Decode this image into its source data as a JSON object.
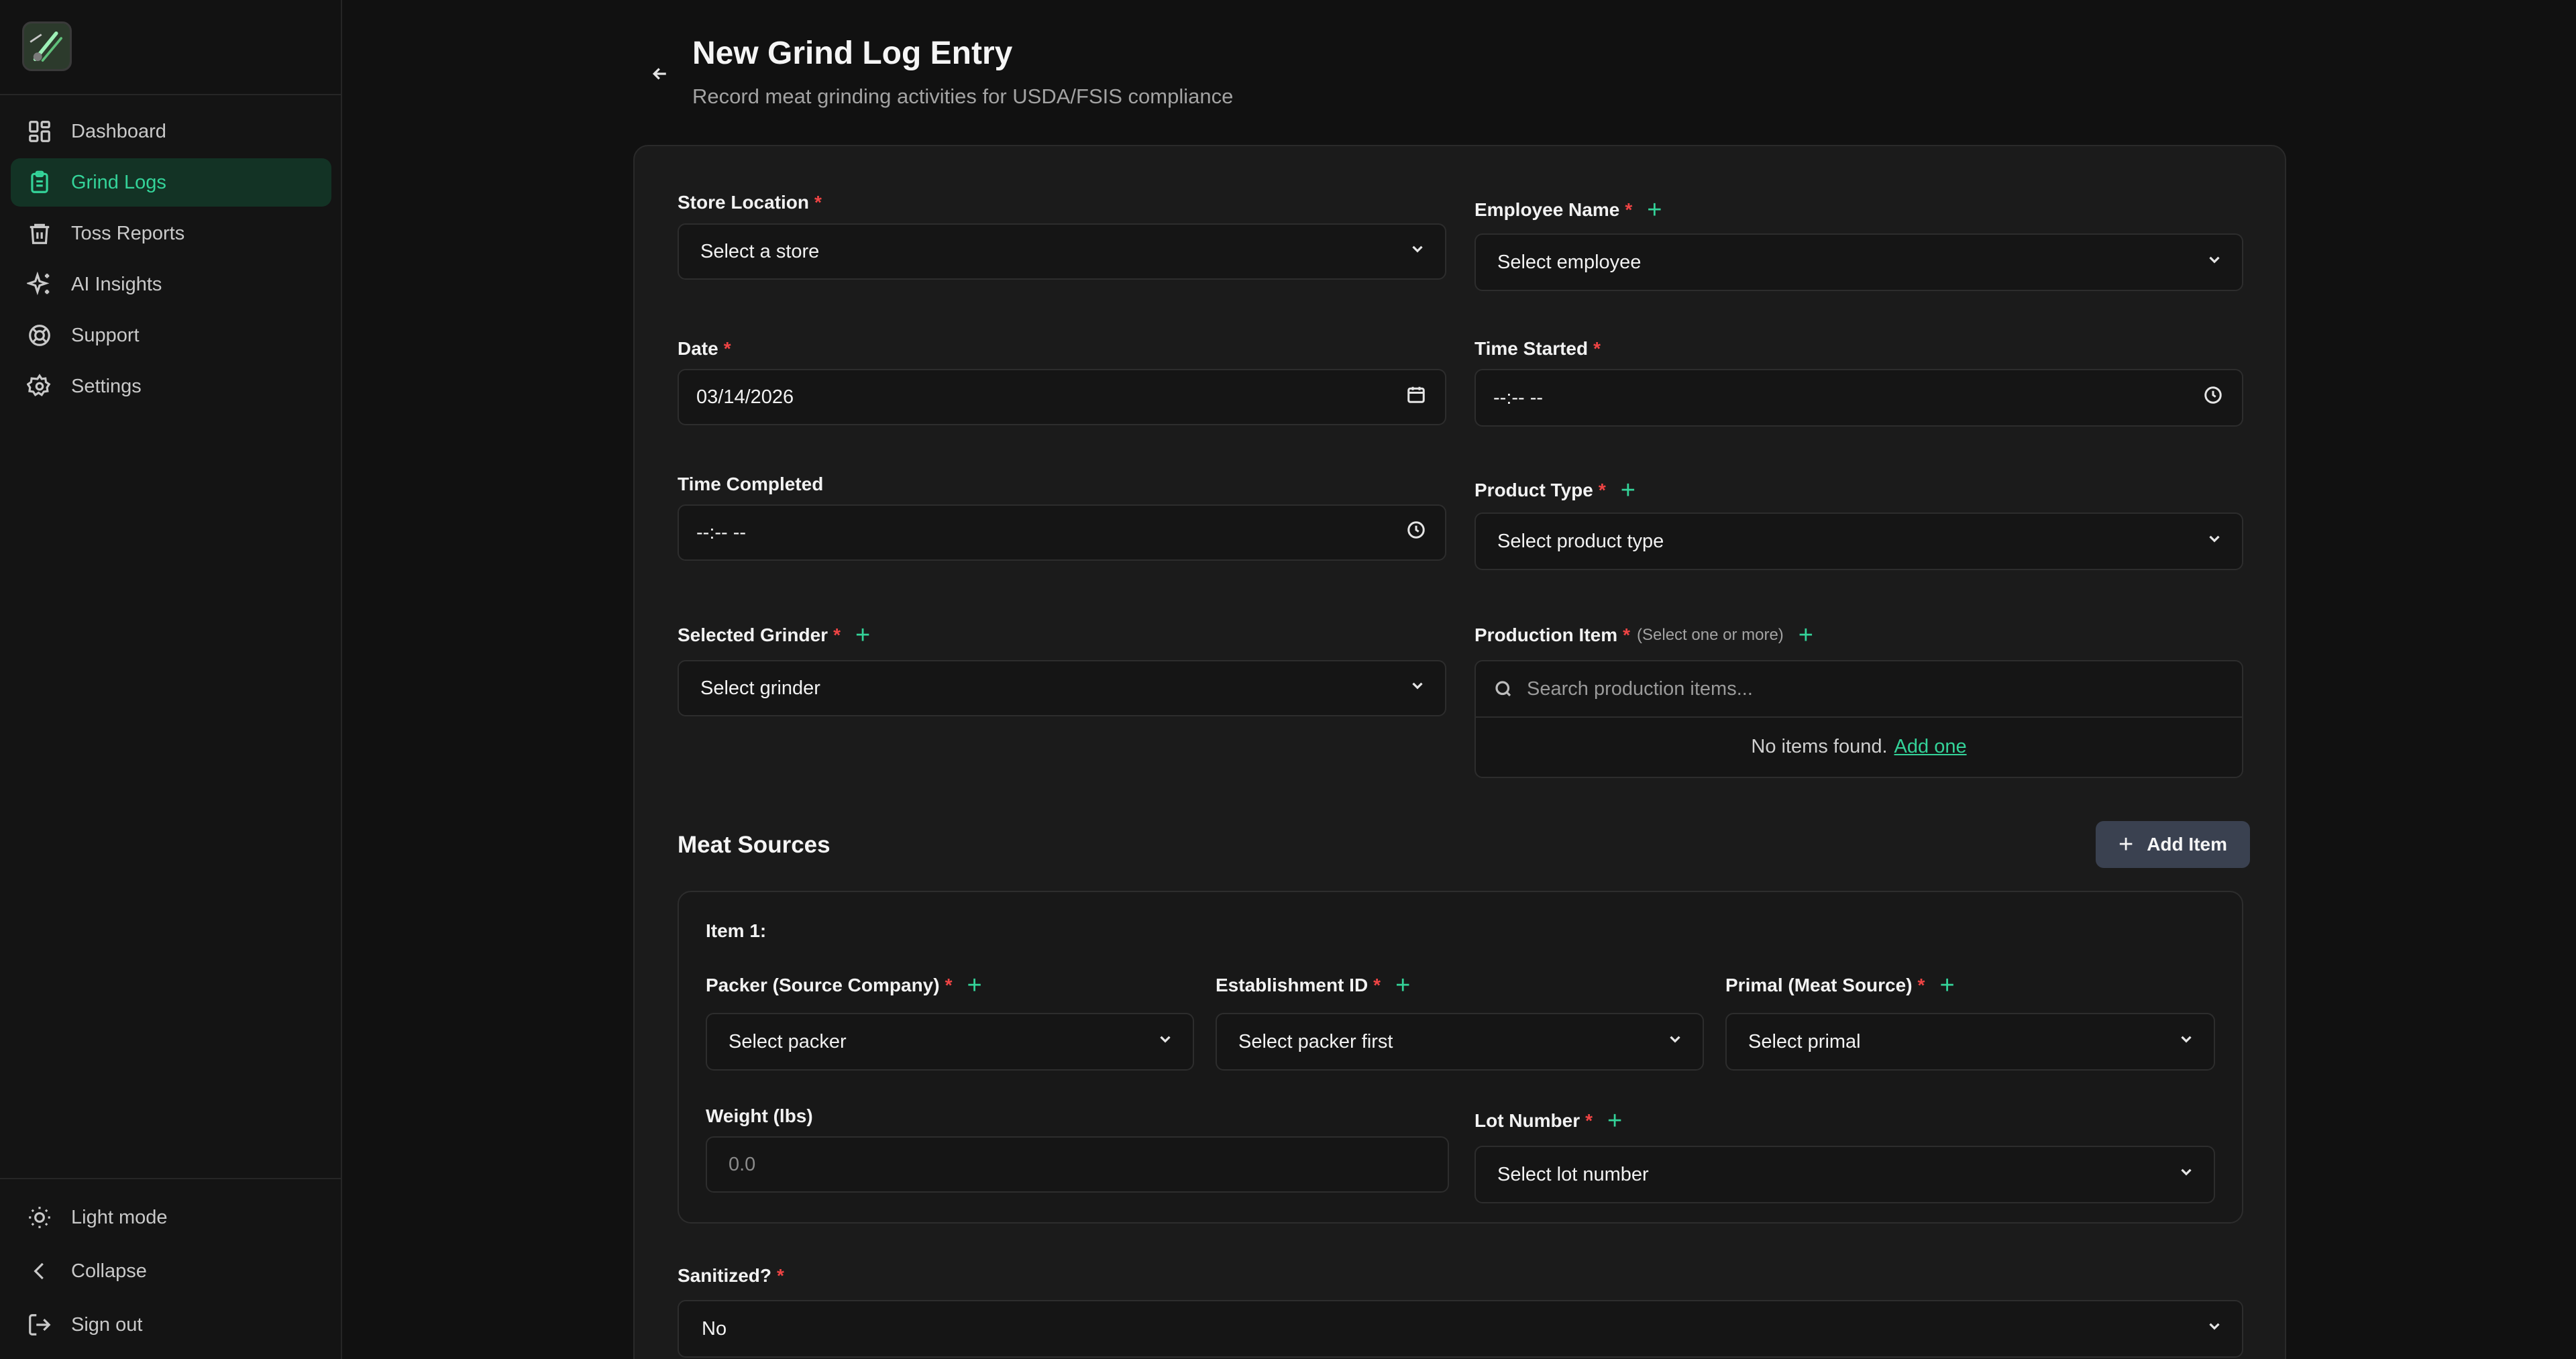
{
  "sidebar": {
    "items": [
      {
        "label": "Dashboard"
      },
      {
        "label": "Grind Logs"
      },
      {
        "label": "Toss Reports"
      },
      {
        "label": "AI Insights"
      },
      {
        "label": "Support"
      },
      {
        "label": "Settings"
      }
    ],
    "bottom": [
      {
        "label": "Light mode"
      },
      {
        "label": "Collapse"
      },
      {
        "label": "Sign out"
      }
    ],
    "active_color": "#34d399"
  },
  "header": {
    "title": "New Grind Log Entry",
    "subtitle": "Record meat grinding activities for USDA/FSIS compliance"
  },
  "form": {
    "store_location": {
      "label": "Store Location",
      "required": "*",
      "value": "Select a store"
    },
    "employee_name": {
      "label": "Employee Name",
      "required": "*",
      "value": "Select employee"
    },
    "date": {
      "label": "Date",
      "required": "*",
      "value": "03/14/2026"
    },
    "time_started": {
      "label": "Time Started",
      "required": "*",
      "value": "--:-- --"
    },
    "time_completed": {
      "label": "Time Completed",
      "value": "--:-- --"
    },
    "product_type": {
      "label": "Product Type",
      "required": "*",
      "value": "Select product type"
    },
    "selected_grinder": {
      "label": "Selected Grinder",
      "required": "*",
      "value": "Select grinder"
    },
    "production_item": {
      "label": "Production Item",
      "required": "*",
      "hint": "(Select one or more)",
      "search_placeholder": "Search production items...",
      "empty_text": "No items found.",
      "empty_link": "Add one"
    },
    "plus_symbol": "+"
  },
  "meat_sources": {
    "title": "Meat Sources",
    "add_button": "Add Item",
    "items": [
      {
        "heading": "Item 1:",
        "packer": {
          "label": "Packer (Source Company)",
          "required": "*",
          "value": "Select packer"
        },
        "establishment": {
          "label": "Establishment ID",
          "required": "*",
          "value": "Select packer first"
        },
        "primal": {
          "label": "Primal (Meat Source)",
          "required": "*",
          "value": "Select primal"
        },
        "weight": {
          "label": "Weight (lbs)",
          "placeholder": "0.0"
        },
        "lot_number": {
          "label": "Lot Number",
          "required": "*",
          "value": "Select lot number"
        }
      }
    ]
  },
  "sanitized": {
    "label": "Sanitized?",
    "required": "*",
    "value": "No"
  }
}
